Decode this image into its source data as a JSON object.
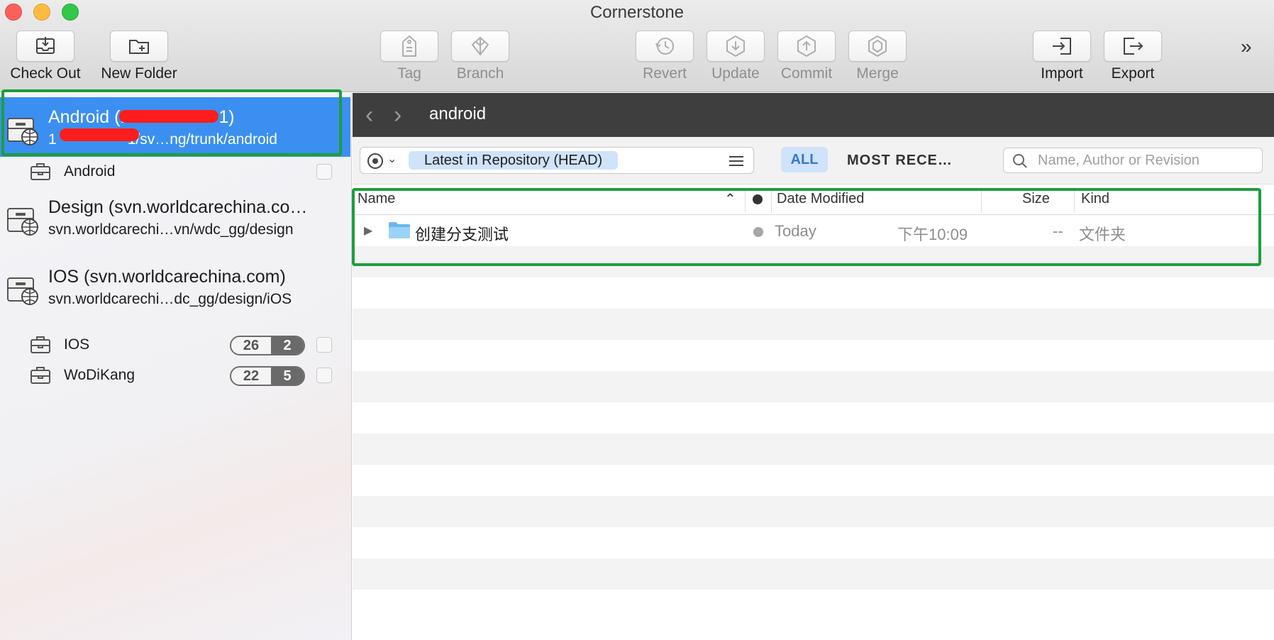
{
  "window": {
    "title": "Cornerstone"
  },
  "toolbar": {
    "checkout": "Check Out",
    "new_folder": "New Folder",
    "tag": "Tag",
    "branch": "Branch",
    "revert": "Revert",
    "update": "Update",
    "commit": "Commit",
    "merge": "Merge",
    "import": "Import",
    "export": "Export",
    "more": "»"
  },
  "sidebar": {
    "repos": [
      {
        "name": "Android (1",
        "name_tail": "1)",
        "url": "1",
        "url_tail": "1/sv…ng/trunk/android",
        "selected": true
      },
      {
        "name": "Design (svn.worldcarechina.co…",
        "url": "svn.worldcarechi…vn/wdc_gg/design",
        "selected": false
      },
      {
        "name": "IOS (svn.worldcarechina.com)",
        "url": "svn.worldcarechi…dc_gg/design/iOS",
        "selected": false
      }
    ],
    "working_copies": [
      {
        "name": "Android"
      },
      {
        "name": "IOS",
        "badge_left": "26",
        "badge_right": "2"
      },
      {
        "name": "WoDiKang",
        "badge_left": "22",
        "badge_right": "5"
      }
    ]
  },
  "pathbar": {
    "title": "android",
    "back": "‹",
    "forward": "›"
  },
  "filter": {
    "revision": "Latest in Repository (HEAD)",
    "segment_all": "ALL",
    "segment_recent": "MOST RECE…",
    "search_placeholder": "Name, Author or Revision"
  },
  "table": {
    "headers": {
      "name": "Name",
      "date": "Date Modified",
      "size": "Size",
      "kind": "Kind"
    },
    "rows": [
      {
        "name": "创建分支测试",
        "date": "Today",
        "time": "下午10:09",
        "size": "--",
        "kind": "文件夹"
      }
    ]
  },
  "colors": {
    "selection": "#3b8ff0",
    "highlight_frame": "#1e9e3c",
    "pathbar": "#3e3e3e"
  },
  "icons": [
    "checkout-icon",
    "new-folder-icon",
    "tag-icon",
    "branch-icon",
    "revert-icon",
    "update-icon",
    "commit-icon",
    "merge-icon",
    "import-icon",
    "export-icon",
    "repository-icon",
    "working-copy-icon",
    "folder-icon",
    "search-icon"
  ]
}
